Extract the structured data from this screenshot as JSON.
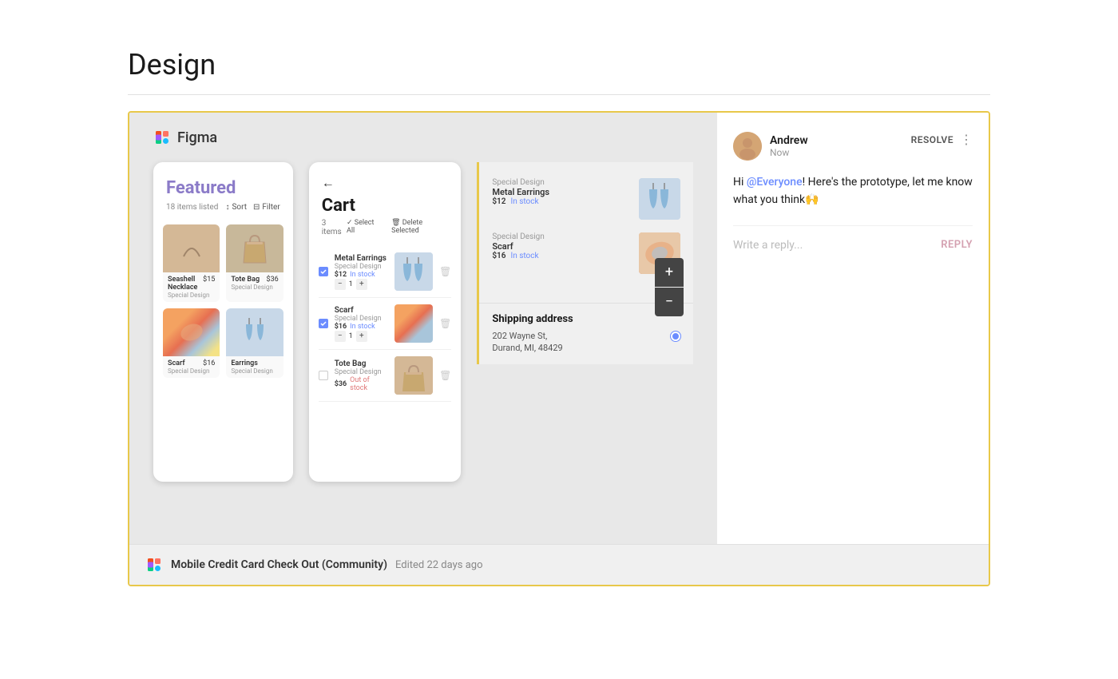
{
  "page": {
    "title": "Design"
  },
  "figma": {
    "logo": "Figma",
    "frame1": {
      "title": "Featured",
      "items_count": "18 items listed",
      "sort_label": "Sort",
      "filter_label": "Filter",
      "products": [
        {
          "name": "Seashell Necklace",
          "price": "$15",
          "subtitle": "Special Design",
          "img_type": "necklace"
        },
        {
          "name": "Tote Bag",
          "price": "$36",
          "subtitle": "Special Design",
          "img_type": "tote"
        },
        {
          "name": "Scarf",
          "price": "$16",
          "subtitle": "Special Design",
          "img_type": "scarf"
        },
        {
          "name": "Earrings",
          "price": "",
          "subtitle": "Special Design",
          "img_type": "earrings"
        }
      ]
    },
    "frame2": {
      "title": "Cart",
      "items_count": "3 items",
      "select_all": "Select All",
      "delete_selected": "Delete Selected",
      "items": [
        {
          "name": "Metal Earrings",
          "subtitle": "Special Design",
          "price": "$12",
          "status": "In stock",
          "checked": true,
          "img_type": "earrings"
        },
        {
          "name": "Scarf",
          "subtitle": "Special Design",
          "price": "$16",
          "status": "In stock",
          "checked": true,
          "img_type": "scarf"
        },
        {
          "name": "Tote Bag",
          "subtitle": "Special Design",
          "price": "$36",
          "status": "Out of stock",
          "checked": false,
          "img_type": "tote"
        }
      ]
    },
    "extended": {
      "items": [
        {
          "subtitle": "Special Design",
          "name": "Metal Earrings",
          "price": "$12",
          "status": "In stock",
          "img_type": "earrings"
        },
        {
          "subtitle": "Special Design",
          "name": "Scarf",
          "price": "$16",
          "status": "In stock",
          "img_type": "scarf"
        }
      ],
      "shipping": {
        "title": "Shipping address",
        "address_line1": "202 Wayne St,",
        "address_line2": "Durand, MI, 48429"
      }
    },
    "zoom_plus": "+",
    "zoom_minus": "−"
  },
  "comment": {
    "author": "Andrew",
    "time": "Now",
    "resolve_label": "RESOLVE",
    "more_icon": "⋮",
    "text_parts": [
      {
        "type": "text",
        "content": "Hi "
      },
      {
        "type": "mention",
        "content": "@Everyone"
      },
      {
        "type": "text",
        "content": "! Here's the prototype, let me know what you think🙌"
      }
    ],
    "reply_placeholder": "Write a reply...",
    "reply_label": "REPLY"
  },
  "footer": {
    "filename": "Mobile Credit Card Check Out (Community)",
    "meta": "Edited 22 days ago"
  }
}
